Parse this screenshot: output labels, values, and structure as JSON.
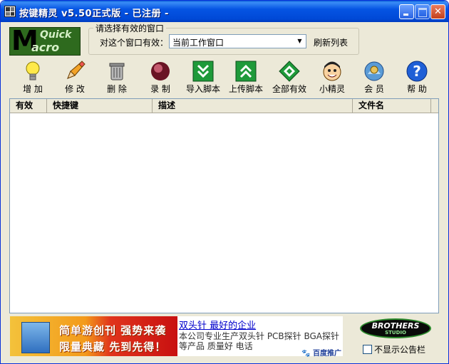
{
  "window": {
    "title": "按键精灵 v5.50正式版 - 已注册 -",
    "accent": "#0054e3"
  },
  "logo": {
    "line1": "Quick",
    "line2": "acro",
    "big": "M"
  },
  "window_select": {
    "group_label": "请选择有效的窗口",
    "label": "对这个窗口有效：",
    "value": "当前工作窗口",
    "refresh": "刷新列表"
  },
  "toolbar": [
    {
      "label": "增 加",
      "icon": "lightbulb-icon"
    },
    {
      "label": "修 改",
      "icon": "pencil-icon"
    },
    {
      "label": "删 除",
      "icon": "trash-icon"
    },
    {
      "label": "录 制",
      "icon": "record-icon"
    },
    {
      "label": "导入脚本",
      "icon": "import-icon"
    },
    {
      "label": "上传脚本",
      "icon": "upload-icon"
    },
    {
      "label": "全部有效",
      "icon": "all-valid-icon"
    },
    {
      "label": "小精灵",
      "icon": "sprite-face-icon"
    },
    {
      "label": "会 员",
      "icon": "member-icon"
    },
    {
      "label": "帮 助",
      "icon": "help-icon"
    }
  ],
  "table": {
    "columns": [
      "有效",
      "快捷键",
      "描述",
      "文件名"
    ],
    "rows": []
  },
  "ad": {
    "banner_line1": "简单游创刊  强势来袭",
    "banner_line2": "限量典藏  先到先得！",
    "link": "双头针 最好的企业",
    "desc1": "本公司专业生产双头针 PCB探针 BGA探针",
    "desc2": "等产品 质量好 电话",
    "source": "百度推广"
  },
  "brand": {
    "name": "BROTHERS",
    "sub": "STUDIO"
  },
  "notice_checkbox": {
    "label": "不显示公告栏",
    "checked": false
  }
}
